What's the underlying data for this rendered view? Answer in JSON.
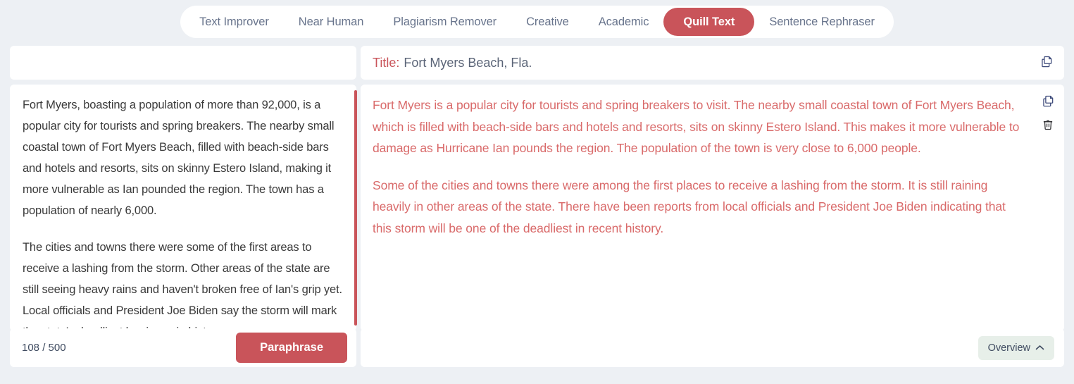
{
  "tabs": [
    {
      "label": "Text Improver",
      "active": false
    },
    {
      "label": "Near Human",
      "active": false
    },
    {
      "label": "Plagiarism Remover",
      "active": false
    },
    {
      "label": "Creative",
      "active": false
    },
    {
      "label": "Academic",
      "active": false
    },
    {
      "label": "Quill Text",
      "active": true
    },
    {
      "label": "Sentence Rephraser",
      "active": false
    }
  ],
  "input_panel": {
    "title_field_value": "",
    "title_field_placeholder": "",
    "paragraphs": [
      "Fort Myers, boasting a population of more than 92,000, is a popular city for tourists and spring breakers. The nearby small coastal town of Fort Myers Beach, filled with beach-side bars and hotels and resorts, sits on skinny Estero Island, making it more vulnerable as Ian pounded the region. The town has a population of nearly 6,000.",
      "The cities and towns there were some of the first areas to receive a lashing from the storm. Other areas of the state are still seeing heavy rains and haven't broken free of Ian's grip yet. Local officials and President Joe Biden say the storm will mark the state's deadliest hurricane in history."
    ],
    "counter": "108 / 500",
    "paraphrase_label": "Paraphrase"
  },
  "output_panel": {
    "title_label": "Title:",
    "title_value": "Fort Myers Beach, Fla.",
    "paragraphs": [
      "Fort Myers is a popular city for tourists and spring breakers to visit. The nearby small coastal town of Fort Myers Beach, which is filled with beach-side bars and hotels and resorts, sits on skinny Estero Island. This makes it more vulnerable to damage as Hurricane Ian pounds the region. The population of the town is very close to 6,000 people.",
      "Some of the cities and towns there were among the first places to receive a lashing from the storm. It is still raining heavily in other areas of the state. There have been reports from local officials and President Joe Biden indicating that this storm will be one of the deadliest in recent history."
    ],
    "overview_label": "Overview"
  },
  "colors": {
    "accent_red": "#c9545a",
    "output_text": "#d96a6a",
    "page_background": "#edf0f4",
    "tab_text": "#68748c",
    "icon_navy": "#3d4a7a",
    "overview_background": "#e7efe9"
  }
}
